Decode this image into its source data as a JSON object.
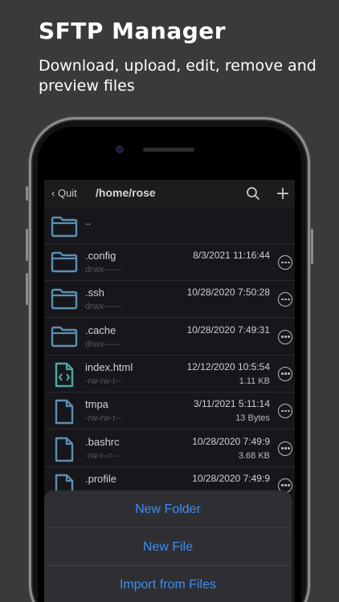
{
  "promo": {
    "title": "SFTP Manager",
    "subtitle": "Download, upload, edit, remove and preview files"
  },
  "nav": {
    "back_label": "Quit",
    "path": "/home/rose",
    "search_icon": "search-icon",
    "add_icon": "plus-icon"
  },
  "files": [
    {
      "name": "..",
      "perm": "",
      "date": "",
      "size": "",
      "icon": "folder-icon"
    },
    {
      "name": ".config",
      "perm": "drwx------",
      "date": "8/3/2021 11:16:44",
      "size": "",
      "icon": "folder-icon"
    },
    {
      "name": ".ssh",
      "perm": "drwx------",
      "date": "10/28/2020 7:50:28",
      "size": "",
      "icon": "folder-icon"
    },
    {
      "name": ".cache",
      "perm": "drwx------",
      "date": "10/28/2020 7:49:31",
      "size": "",
      "icon": "folder-icon"
    },
    {
      "name": "index.html",
      "perm": "-rw-rw-r--",
      "date": "12/12/2020 10:5:54",
      "size": "1.11 KB",
      "icon": "code-file-icon"
    },
    {
      "name": "tmpa",
      "perm": "-rw-rw-r--",
      "date": "3/11/2021 5:11:14",
      "size": "13 Bytes",
      "icon": "file-icon"
    },
    {
      "name": ".bashrc",
      "perm": "-rw-r--r--",
      "date": "10/28/2020 7:49:9",
      "size": "3.68 KB",
      "icon": "file-icon"
    },
    {
      "name": ".profile",
      "perm": "",
      "date": "10/28/2020 7:49:9",
      "size": "",
      "icon": "file-icon"
    }
  ],
  "sheet": {
    "new_folder": "New Folder",
    "new_file": "New File",
    "import": "Import from Files"
  },
  "colors": {
    "background": "#3a3a3b",
    "accent": "#3d8ef5",
    "folder": "#5b8fb3",
    "code_file": "#4fa8a0"
  }
}
